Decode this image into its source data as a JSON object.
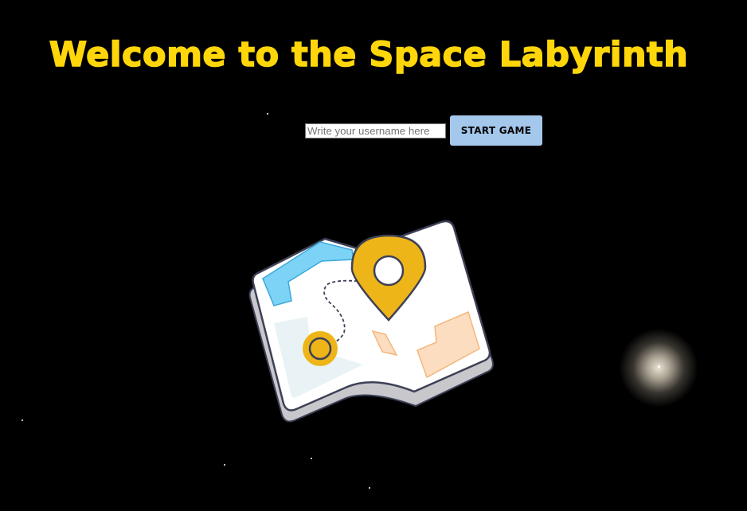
{
  "page": {
    "title": "Welcome to the Space Labyrinth"
  },
  "login": {
    "username_placeholder": "Write your username here",
    "username_value": "",
    "start_button_label": "START GAME"
  },
  "illustration": {
    "icon": "map-with-location-pin-icon"
  },
  "colors": {
    "background": "#000000",
    "title": "#FFD60A",
    "button": "#A4C8EC",
    "pin": "#EDB518",
    "water": "#7DD3F5",
    "area": "#FCDDBF"
  }
}
